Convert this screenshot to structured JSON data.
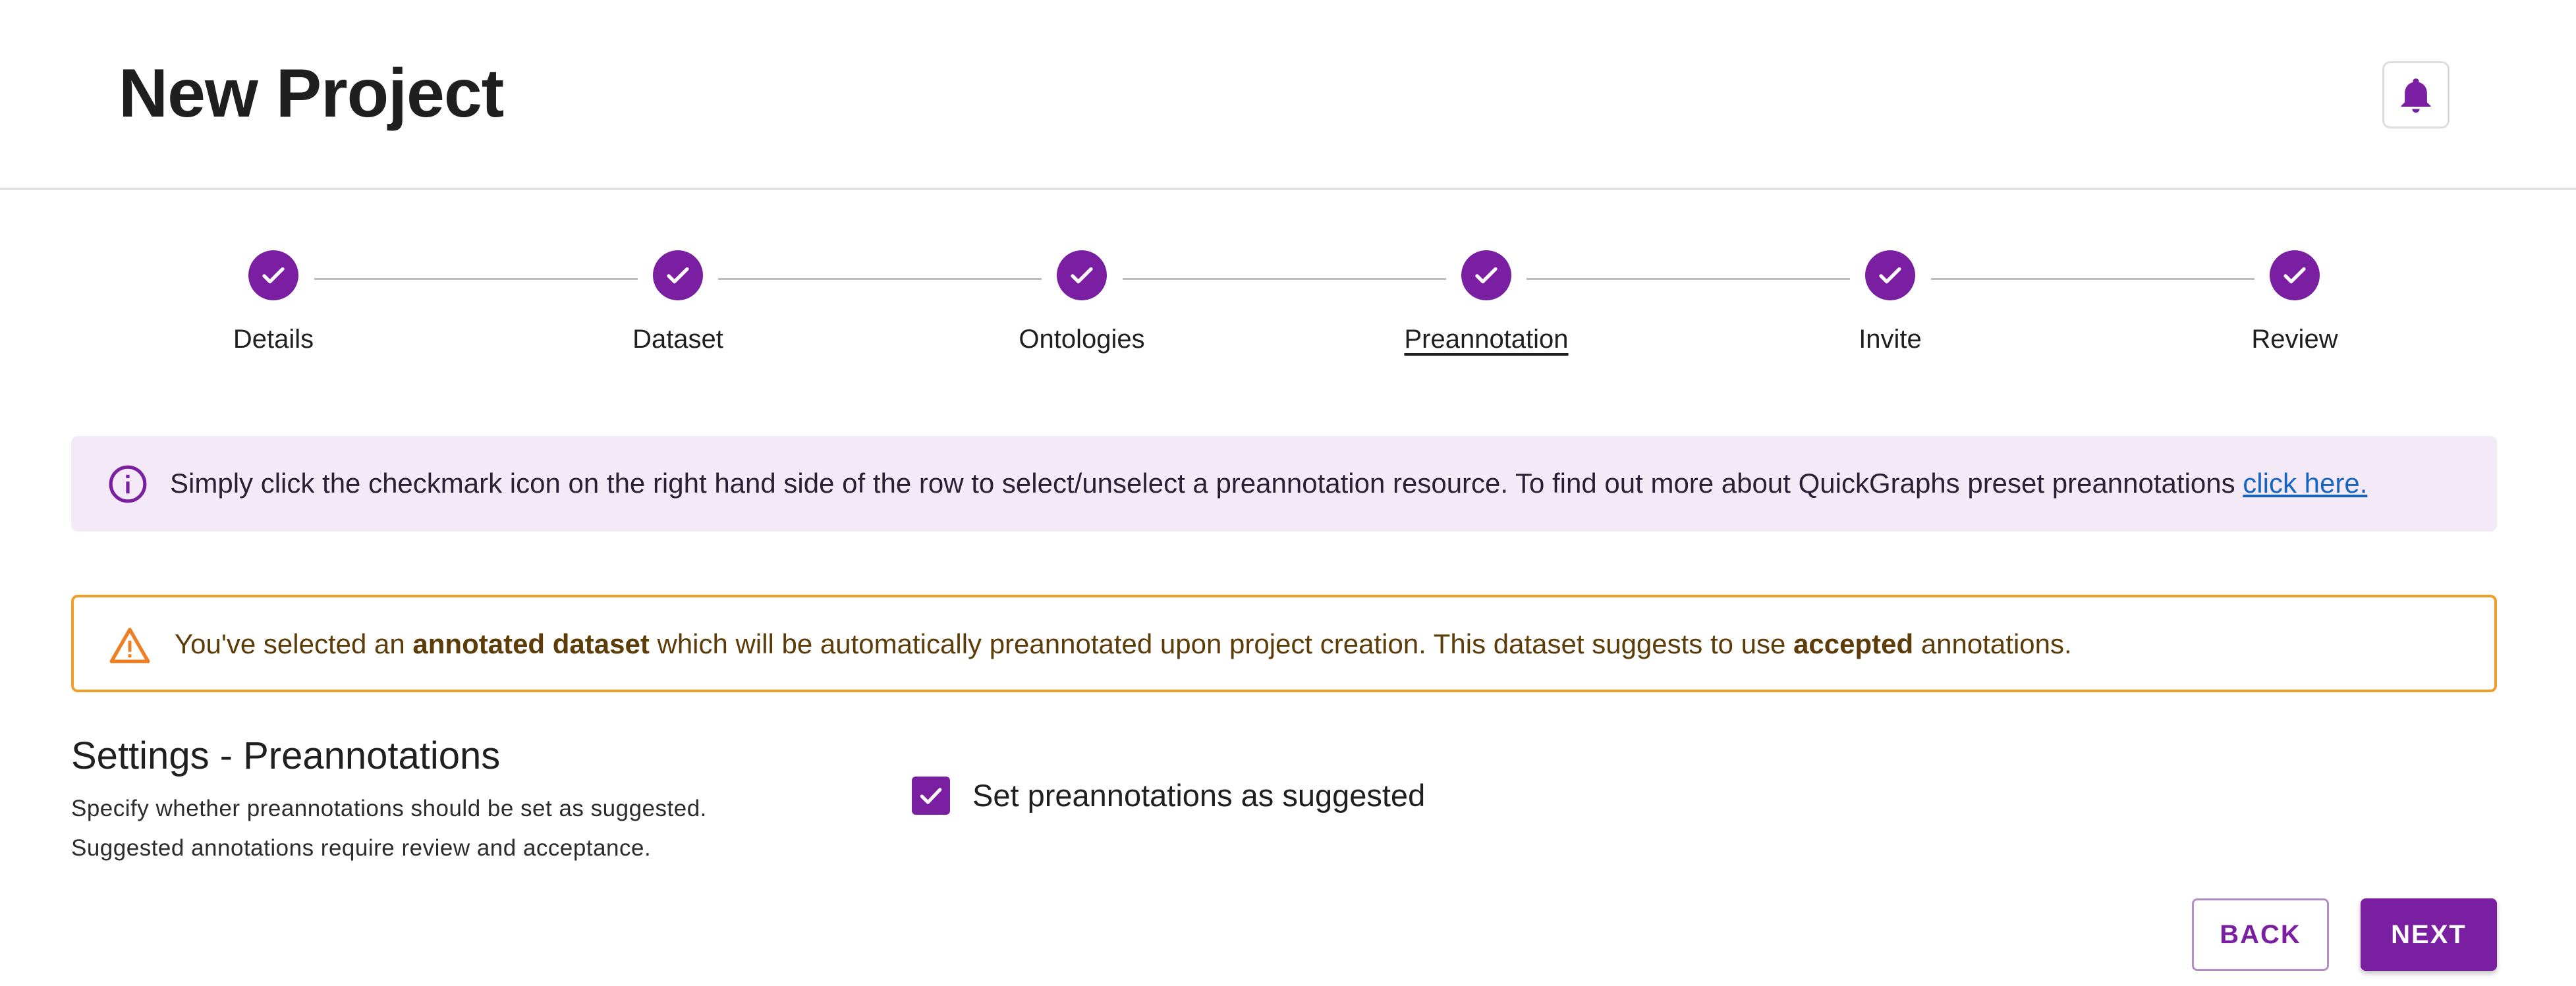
{
  "header": {
    "title": "New Project"
  },
  "stepper": {
    "steps": [
      {
        "label": "Details",
        "completed": true
      },
      {
        "label": "Dataset",
        "completed": true
      },
      {
        "label": "Ontologies",
        "completed": true
      },
      {
        "label": "Preannotation",
        "completed": true,
        "active": true
      },
      {
        "label": "Invite",
        "completed": true
      },
      {
        "label": "Review",
        "completed": true
      }
    ]
  },
  "info_alert": {
    "text": "Simply click the checkmark icon on the right hand side of the row to select/unselect a preannotation resource. To find out more about QuickGraphs preset preannotations ",
    "link_text": "click here."
  },
  "warning_alert": {
    "part1": "You've selected an ",
    "bold1": "annotated dataset",
    "part2": " which will be automatically preannotated upon project creation. This dataset suggests to use ",
    "bold2": "accepted",
    "part3": " annotations."
  },
  "settings": {
    "title": "Settings - Preannotations",
    "description_line1": "Specify whether preannotations should be set as suggested.",
    "description_line2": "Suggested annotations require review and acceptance.",
    "checkbox_label": "Set preannotations as suggested",
    "checkbox_checked": true
  },
  "actions": {
    "back_label": "BACK",
    "next_label": "NEXT"
  },
  "colors": {
    "primary": "#7b1fa2",
    "info_bg": "#f3e9f7",
    "warning_border": "#ef9e2b",
    "warning_text": "#5d3c08",
    "link": "#1565c0"
  }
}
